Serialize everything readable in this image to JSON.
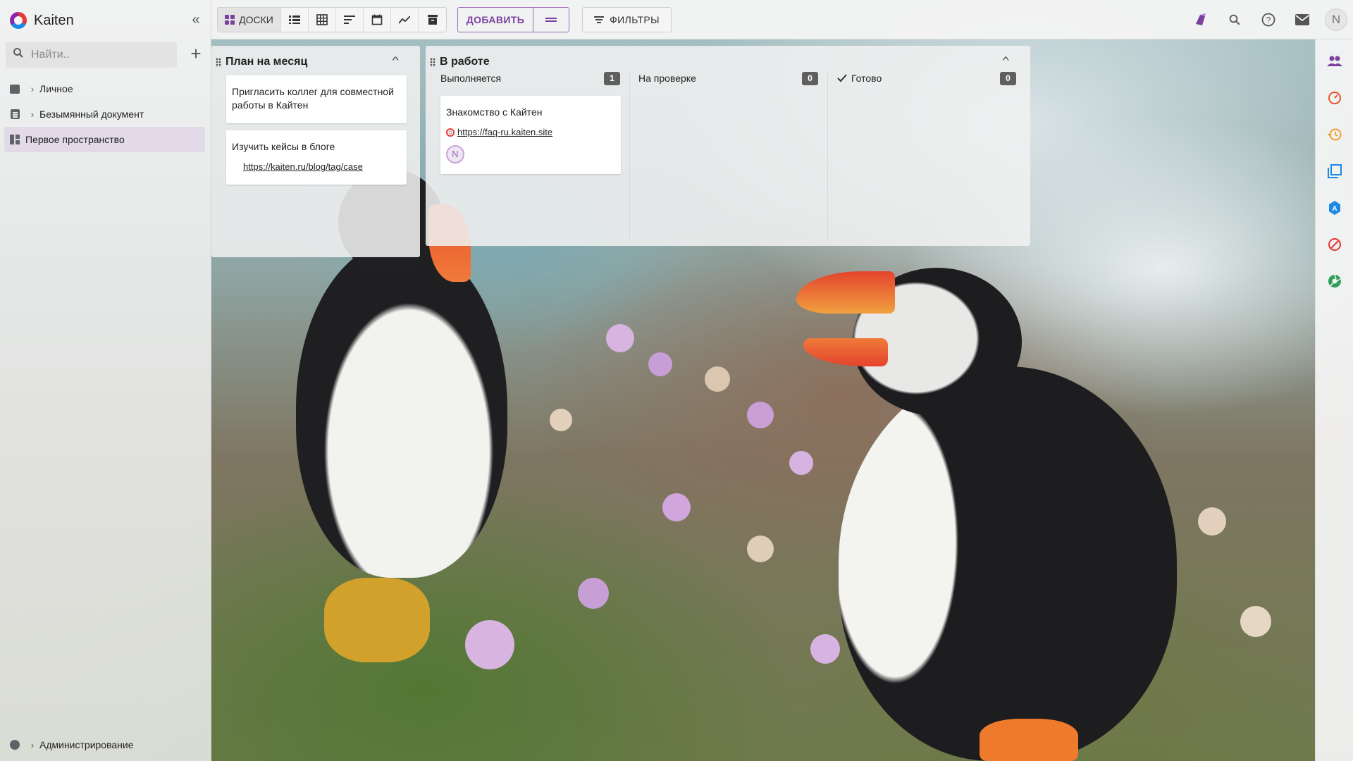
{
  "app": {
    "name": "Kaiten"
  },
  "sidebar": {
    "search_placeholder": "Найти..",
    "items": [
      {
        "label": "Личное",
        "icon": "folder-icon"
      },
      {
        "label": "Безымянный документ",
        "icon": "document-icon"
      },
      {
        "label": "Первое пространство",
        "icon": "space-icon",
        "active": true
      }
    ],
    "admin_label": "Администрирование"
  },
  "toolbar": {
    "boards_label": "ДОСКИ",
    "views": [
      "list-view-icon",
      "table-view-icon",
      "timeline-view-icon",
      "calendar-view-icon",
      "chart-view-icon",
      "archive-icon"
    ],
    "add_label": "ДОБАВИТЬ",
    "filters_label": "ФИЛЬТРЫ",
    "user_initial": "N"
  },
  "lanes": [
    {
      "title": "План на месяц",
      "cards": [
        {
          "title": "Пригласить коллег для совместной работы в Кайтен"
        },
        {
          "title": "Изучить кейсы в блоге",
          "link": "https://kaiten.ru/blog/tag/case"
        }
      ]
    },
    {
      "title": "В работе",
      "columns": [
        {
          "name": "Выполняется",
          "count": "1"
        },
        {
          "name": "На проверке",
          "count": "0"
        },
        {
          "name": "Готово",
          "count": "0",
          "done": true
        }
      ],
      "cards": [
        {
          "title": "Знакомство с Кайтен",
          "link": "https://faq-ru.kaiten.site",
          "member": "N"
        }
      ]
    }
  ],
  "colors": {
    "accent": "#7b3fa0",
    "count_badge": "#5f5f5f"
  }
}
